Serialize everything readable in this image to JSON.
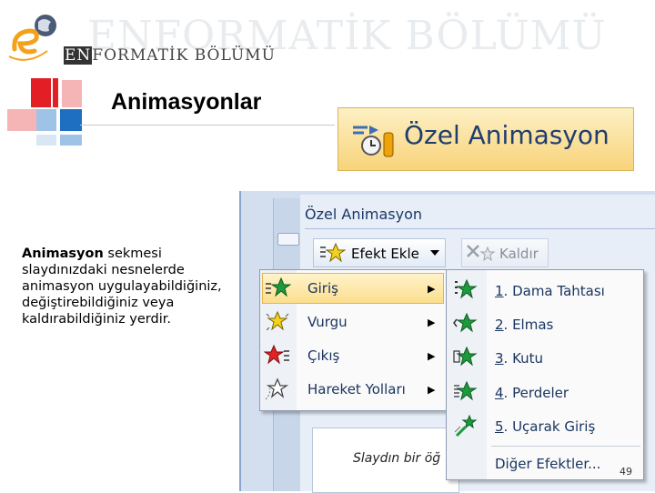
{
  "header": {
    "watermark": "ENFORMATİK BÖLÜMÜ",
    "brand_prefix": "EN",
    "brand_rest": "FORMATİK BÖLÜMÜ"
  },
  "slide": {
    "title": "Animasyonlar",
    "body_bold": "Animasyon",
    "body_rest": " sekmesi slaydınızdaki nesnelerde animasyon uygulayabildiğiniz, değiştirebildiğiniz veya kaldırabildiğiniz yerdir.",
    "page_number": "49"
  },
  "ribbon": {
    "button_label": "Özel Animasyon"
  },
  "pane": {
    "title": "Özel Animasyon",
    "add_effect_label": "Efekt Ekle",
    "remove_label": "Kaldır",
    "slide_hint": "Slaydın bir öğ"
  },
  "menu": {
    "items": [
      {
        "label": "Giriş",
        "icon": "star-green-icon"
      },
      {
        "label": "Vurgu",
        "icon": "star-yellow-icon"
      },
      {
        "label": "Çıkış",
        "icon": "star-red-icon"
      },
      {
        "label": "Hareket Yolları",
        "icon": "star-outline-icon"
      }
    ]
  },
  "submenu": {
    "items": [
      {
        "num": "1",
        "label": ". Dama Tahtası"
      },
      {
        "num": "2",
        "label": ". Elmas"
      },
      {
        "num": "3",
        "label": ". Kutu"
      },
      {
        "num": "4",
        "label": ". Perdeler"
      },
      {
        "num": "5",
        "label": ". Uçarak Giriş"
      }
    ],
    "more_label": "Diğer Efektler..."
  },
  "colors": {
    "accent_text": "#1a3561",
    "highlight": "#fcdf8e",
    "pane_bg": "#e7eef8"
  }
}
